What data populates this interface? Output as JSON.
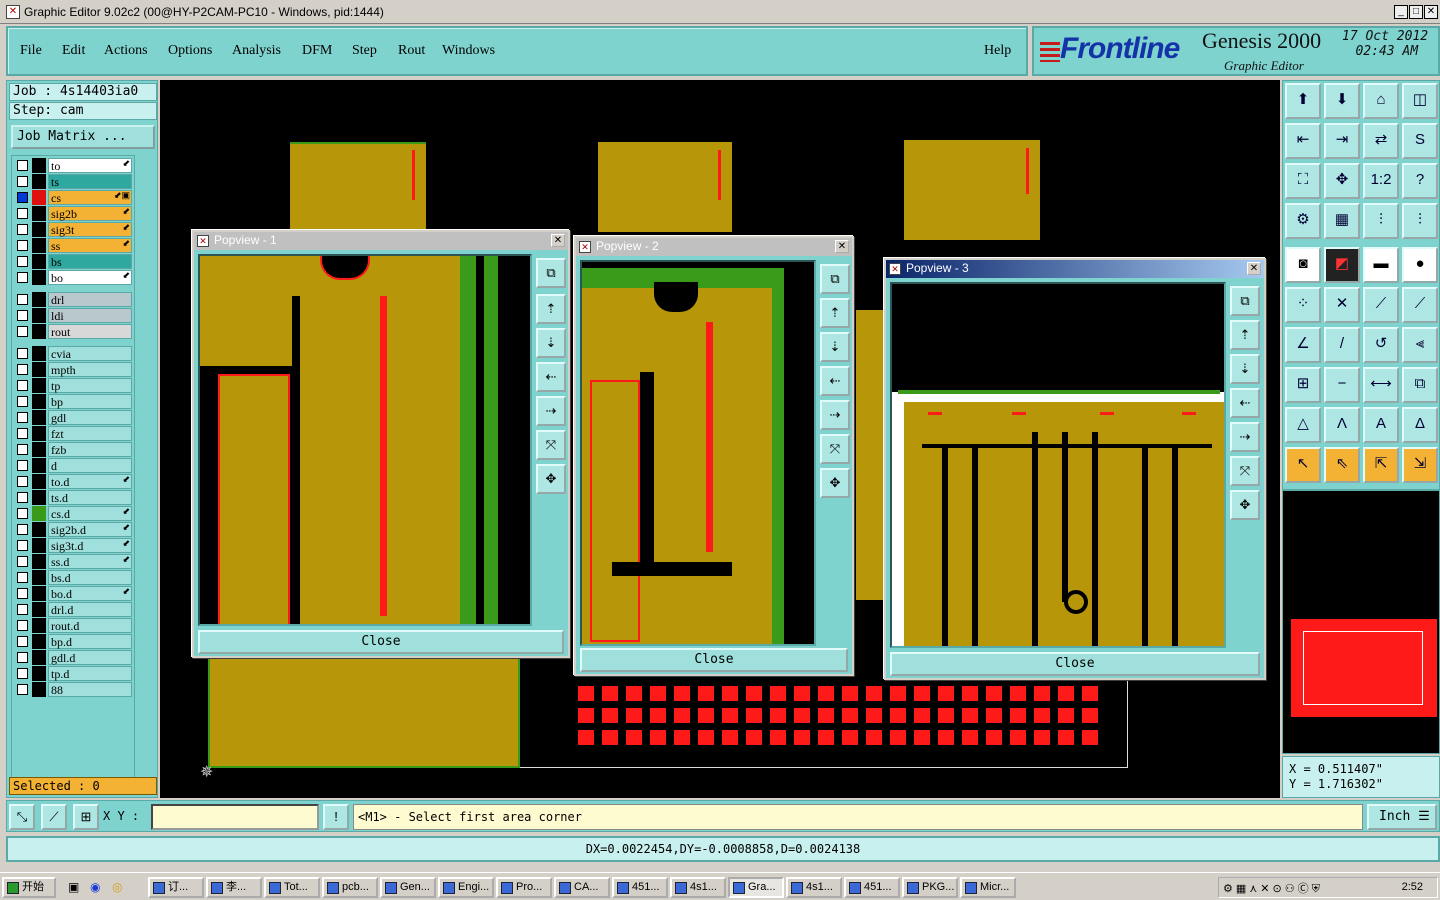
{
  "window": {
    "title": "Graphic Editor 9.02c2 (00@HY-P2CAM-PC10 - Windows, pid:1444)",
    "app_icon": "x-icon"
  },
  "menu": {
    "items": [
      "File",
      "Edit",
      "Actions",
      "Options",
      "Analysis",
      "DFM",
      "Step",
      "Rout",
      "Windows"
    ],
    "help": "Help"
  },
  "brand": {
    "logo": "Frontline",
    "product": "Genesis 2000",
    "subtitle": "Graphic Editor",
    "date": "17 Oct 2012",
    "time": "02:43 AM"
  },
  "job": {
    "job_line": "Job : 4s14403ia0",
    "step_line": "Step: cam",
    "matrix_button": "Job Matrix ..."
  },
  "layers": [
    {
      "name": "to",
      "color": "#ffffff",
      "checked": false,
      "swatch": "#000000",
      "flag": "⬋"
    },
    {
      "name": "ts",
      "color": "#2fa8a0",
      "checked": false,
      "swatch": "#000000",
      "flag": ""
    },
    {
      "name": "cs",
      "color": "#f3b234",
      "checked": true,
      "swatch": "#e01010",
      "flag": "⬋▣"
    },
    {
      "name": "sig2b",
      "color": "#f3b234",
      "checked": false,
      "swatch": "#000000",
      "flag": "⬋"
    },
    {
      "name": "sig3t",
      "color": "#f3b234",
      "checked": false,
      "swatch": "#000000",
      "flag": "⬋"
    },
    {
      "name": "ss",
      "color": "#f3b234",
      "checked": false,
      "swatch": "#000000",
      "flag": "⬋"
    },
    {
      "name": "bs",
      "color": "#2fa8a0",
      "checked": false,
      "swatch": "#000000",
      "flag": ""
    },
    {
      "name": "bo",
      "color": "#ffffff",
      "checked": false,
      "swatch": "#000000",
      "flag": "⬋"
    },
    {
      "name": "drl",
      "color": "#b8c8cc",
      "checked": false,
      "swatch": "#000000",
      "flag": ""
    },
    {
      "name": "ldi",
      "color": "#b8c8cc",
      "checked": false,
      "swatch": "#000000",
      "flag": ""
    },
    {
      "name": "rout",
      "color": "#d8d8d8",
      "checked": false,
      "swatch": "#000000",
      "flag": ""
    },
    {
      "name": "cvia",
      "color": "#9fe0dc",
      "checked": false,
      "swatch": "#000000",
      "flag": ""
    },
    {
      "name": "mpth",
      "color": "#9fe0dc",
      "checked": false,
      "swatch": "#000000",
      "flag": ""
    },
    {
      "name": "tp",
      "color": "#9fe0dc",
      "checked": false,
      "swatch": "#000000",
      "flag": ""
    },
    {
      "name": "bp",
      "color": "#9fe0dc",
      "checked": false,
      "swatch": "#000000",
      "flag": ""
    },
    {
      "name": "gdl",
      "color": "#9fe0dc",
      "checked": false,
      "swatch": "#000000",
      "flag": ""
    },
    {
      "name": "fzt",
      "color": "#9fe0dc",
      "checked": false,
      "swatch": "#000000",
      "flag": ""
    },
    {
      "name": "fzb",
      "color": "#9fe0dc",
      "checked": false,
      "swatch": "#000000",
      "flag": ""
    },
    {
      "name": "d",
      "color": "#9fe0dc",
      "checked": false,
      "swatch": "#000000",
      "flag": ""
    },
    {
      "name": "to.d",
      "color": "#9fe0dc",
      "checked": false,
      "swatch": "#000000",
      "flag": "⬋"
    },
    {
      "name": "ts.d",
      "color": "#9fe0dc",
      "checked": false,
      "swatch": "#000000",
      "flag": ""
    },
    {
      "name": "cs.d",
      "color": "#9fe0dc",
      "checked": false,
      "swatch": "#3a9a1a",
      "flag": "⬋"
    },
    {
      "name": "sig2b.d",
      "color": "#9fe0dc",
      "checked": false,
      "swatch": "#000000",
      "flag": "⬋"
    },
    {
      "name": "sig3t.d",
      "color": "#9fe0dc",
      "checked": false,
      "swatch": "#000000",
      "flag": "⬋"
    },
    {
      "name": "ss.d",
      "color": "#9fe0dc",
      "checked": false,
      "swatch": "#000000",
      "flag": "⬋"
    },
    {
      "name": "bs.d",
      "color": "#9fe0dc",
      "checked": false,
      "swatch": "#000000",
      "flag": ""
    },
    {
      "name": "bo.d",
      "color": "#9fe0dc",
      "checked": false,
      "swatch": "#000000",
      "flag": "⬋"
    },
    {
      "name": "drl.d",
      "color": "#9fe0dc",
      "checked": false,
      "swatch": "#000000",
      "flag": ""
    },
    {
      "name": "rout.d",
      "color": "#9fe0dc",
      "checked": false,
      "swatch": "#000000",
      "flag": ""
    },
    {
      "name": "bp.d",
      "color": "#9fe0dc",
      "checked": false,
      "swatch": "#000000",
      "flag": ""
    },
    {
      "name": "gdl.d",
      "color": "#9fe0dc",
      "checked": false,
      "swatch": "#000000",
      "flag": ""
    },
    {
      "name": "tp.d",
      "color": "#9fe0dc",
      "checked": false,
      "swatch": "#000000",
      "flag": ""
    },
    {
      "name": "88",
      "color": "#9fe0dc",
      "checked": false,
      "swatch": "#000000",
      "flag": ""
    }
  ],
  "selected": "Selected : 0",
  "popups": [
    {
      "title": "Popview - 1",
      "close": "Close",
      "close_icon": "close-icon"
    },
    {
      "title": "Popview - 2",
      "close": "Close",
      "close_icon": "close-icon"
    },
    {
      "title": "Popview - 3",
      "close": "Close",
      "close_icon": "close-icon"
    }
  ],
  "coords": {
    "x": "X = 0.511407\"",
    "y": "Y = 1.716302\""
  },
  "command": {
    "xy_label": "X Y :",
    "xy_value": "",
    "prompt": "<M1> - Select first area corner",
    "unit": "Inch"
  },
  "measure": "DX=0.0022454,DY=-0.0008858,D=0.0024138",
  "taskbar": {
    "start": "开始",
    "tasks": [
      "订...",
      "李...",
      "Tot...",
      "pcb...",
      "Gen...",
      "Engi...",
      "Pro...",
      "CA...",
      "451...",
      "4s1...",
      "Gra...",
      "4s1...",
      "451...",
      "PKG...",
      "Micr..."
    ],
    "active_index": 10,
    "clock": "2:52"
  },
  "colors": {
    "panel": "#7fd3cf",
    "copper": "#b8960a",
    "soldermask": "#3a9a1a",
    "highlight": "#ff1a1a",
    "accent": "#f3b234"
  }
}
